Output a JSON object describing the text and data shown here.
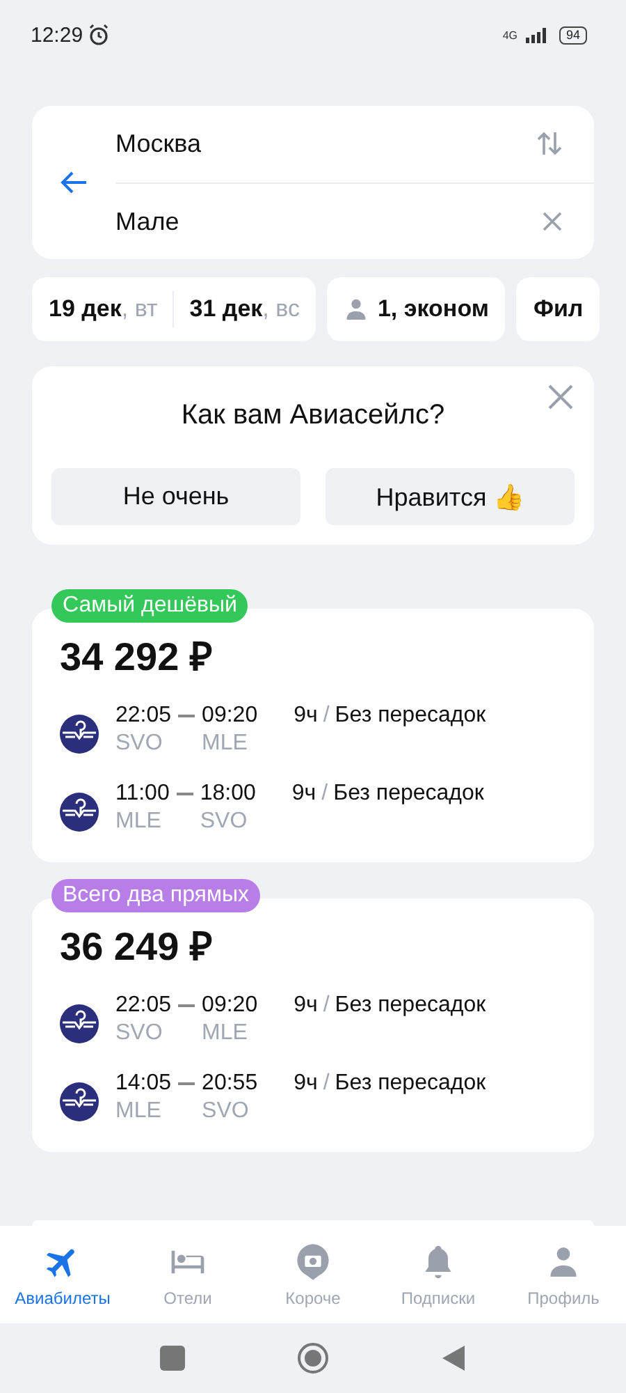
{
  "status_bar": {
    "time": "12:29",
    "network": "4G",
    "battery": "94"
  },
  "search": {
    "origin": "Москва",
    "destination": "Мале"
  },
  "chips": [
    {
      "kind": "dates",
      "depart_date": "19 дек",
      "depart_day": ", вт",
      "return_date": "31 дек",
      "return_day": ", вс"
    },
    {
      "kind": "passengers",
      "label": "1, эконом"
    },
    {
      "kind": "filter",
      "label": "Фил"
    }
  ],
  "rating_prompt": {
    "title": "Как вам Авиасейлс?",
    "buttons": [
      {
        "label": "Не очень"
      },
      {
        "label": "Нравится",
        "emoji": "👍"
      }
    ]
  },
  "tickets": [
    {
      "badge": "Самый дешёвый",
      "color": "#34c759",
      "price": "34 292 ₽",
      "segments": [
        {
          "dep_time": "22:05",
          "arr_time": "09:20",
          "dep_airport": "SVO",
          "arr_airport": "MLE",
          "duration": "9ч",
          "separator": "/",
          "stops": "Без пересадок"
        },
        {
          "dep_time": "11:00",
          "arr_time": "18:00",
          "dep_airport": "MLE",
          "arr_airport": "SVO",
          "duration": "9ч",
          "separator": "/",
          "stops": "Без пересадок"
        }
      ]
    },
    {
      "badge": "Всего два прямых",
      "color": "#b77ee8",
      "price": "36 249 ₽",
      "segments": [
        {
          "dep_time": "22:05",
          "arr_time": "09:20",
          "dep_airport": "SVO",
          "arr_airport": "MLE",
          "duration": "9ч",
          "separator": "/",
          "stops": "Без пересадок"
        },
        {
          "dep_time": "14:05",
          "arr_time": "20:55",
          "dep_airport": "MLE",
          "arr_airport": "SVO",
          "duration": "9ч",
          "separator": "/",
          "stops": "Без пересадок"
        }
      ]
    }
  ],
  "tab_bar": [
    {
      "kind": "plane",
      "label": "Авиабилеты",
      "selected": true
    },
    {
      "kind": "bed",
      "label": "Отели",
      "selected": false
    },
    {
      "kind": "camera",
      "label": "Короче",
      "selected": false
    },
    {
      "kind": "bell",
      "label": "Подписки",
      "selected": false
    },
    {
      "kind": "person",
      "label": "Профиль",
      "selected": false
    }
  ]
}
